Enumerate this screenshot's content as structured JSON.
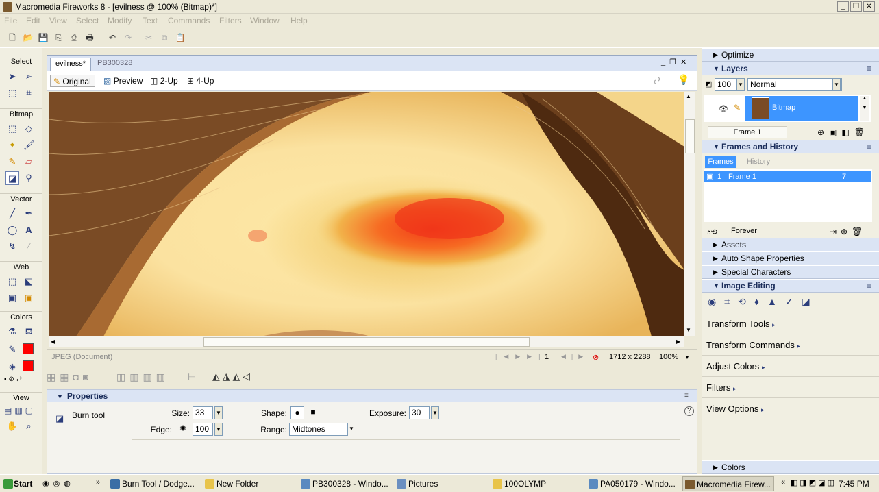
{
  "window": {
    "title": "Macromedia Fireworks 8 - [evilness @ 100% (Bitmap)*]",
    "buttons": [
      "_",
      "❐",
      "✕"
    ]
  },
  "menu": [
    "File",
    "Edit",
    "View",
    "Select",
    "Modify",
    "Text",
    "Commands",
    "Filters",
    "Window",
    "Help"
  ],
  "toolbar": {
    "icons": [
      "new-icon",
      "open-icon",
      "save-icon",
      "import-icon",
      "export-icon",
      "print-icon",
      "undo-icon",
      "redo-icon",
      "cut-icon",
      "copy-icon",
      "paste-icon"
    ]
  },
  "tools": {
    "select": "Select",
    "bitmap": "Bitmap",
    "vector": "Vector",
    "web": "Web",
    "colors": "Colors",
    "view": "View",
    "stroke_color": "#ff0000",
    "fill_color": "#ff0000"
  },
  "document": {
    "tabs": [
      "evilness*",
      "PB300328"
    ],
    "views": [
      "Original",
      "Preview",
      "2-Up",
      "4-Up"
    ],
    "status_format": "JPEG (Document)",
    "frame_num": "1",
    "dimensions": "1712 x 2288",
    "zoom": "100%"
  },
  "properties": {
    "title": "Properties",
    "tool_name": "Burn tool",
    "size_label": "Size:",
    "size_value": "33",
    "edge_label": "Edge:",
    "edge_value": "100",
    "shape_label": "Shape:",
    "range_label": "Range:",
    "range_value": "Midtones",
    "exposure_label": "Exposure:",
    "exposure_value": "30"
  },
  "right_panel": {
    "optimize": "Optimize",
    "layers": "Layers",
    "opacity": "100",
    "blend_mode": "Normal",
    "layer_name": "Bitmap",
    "frame_label": "Frame 1",
    "frames_history": "Frames and History",
    "tab_frames": "Frames",
    "tab_history": "History",
    "frame_row_num": "1",
    "frame_row_name": "Frame 1",
    "frame_row_delay": "7",
    "loop": "Forever",
    "assets": "Assets",
    "auto_shape": "Auto Shape Properties",
    "special_chars": "Special Characters",
    "image_editing": "Image Editing",
    "ie_items": [
      "Transform Tools",
      "Transform Commands",
      "Adjust Colors",
      "Filters",
      "View Options"
    ],
    "colors": "Colors"
  },
  "taskbar": {
    "start": "Start",
    "items": [
      "Burn Tool / Dodge...",
      "New Folder",
      "PB300328 - Windo...",
      "Pictures",
      "100OLYMP",
      "PA050179 - Windo...",
      "Macromedia Firew..."
    ],
    "time": "7:45 PM"
  }
}
